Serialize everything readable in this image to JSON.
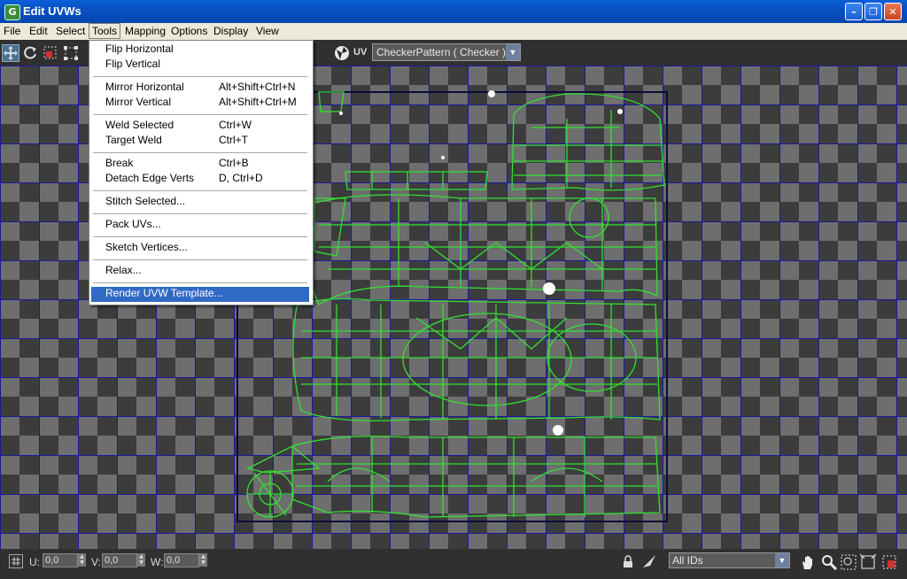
{
  "window": {
    "title": "Edit UVWs",
    "app_icon_glyph": "G"
  },
  "menubar": [
    "File",
    "Edit",
    "Select",
    "Tools",
    "Mapping",
    "Options",
    "Display",
    "View"
  ],
  "toolbar": {
    "uv_label": "UV",
    "texture_combo": "CheckerPattern  ( Checker )"
  },
  "tools_menu": {
    "items": [
      {
        "label": "Flip Horizontal",
        "shortcut": ""
      },
      {
        "label": "Flip Vertical",
        "shortcut": ""
      },
      {
        "label": "Mirror Horizontal",
        "shortcut": "Alt+Shift+Ctrl+N"
      },
      {
        "label": "Mirror Vertical",
        "shortcut": "Alt+Shift+Ctrl+M"
      },
      {
        "label": "Weld Selected",
        "shortcut": "Ctrl+W"
      },
      {
        "label": "Target Weld",
        "shortcut": "Ctrl+T"
      },
      {
        "label": "Break",
        "shortcut": "Ctrl+B"
      },
      {
        "label": "Detach Edge Verts",
        "shortcut": "D, Ctrl+D"
      },
      {
        "label": "Stitch Selected...",
        "shortcut": ""
      },
      {
        "label": "Pack UVs...",
        "shortcut": ""
      },
      {
        "label": "Sketch Vertices...",
        "shortcut": ""
      },
      {
        "label": "Relax...",
        "shortcut": ""
      },
      {
        "label": "Render UVW Template...",
        "shortcut": ""
      }
    ],
    "highlighted": "Render UVW Template..."
  },
  "statusbar": {
    "u_label": "U:",
    "u_value": "0,0",
    "v_label": "V:",
    "v_value": "0,0",
    "w_label": "W:",
    "w_value": "0,0",
    "ids_combo": "All IDs"
  },
  "colors": {
    "accent": "#316ac5",
    "wire": "#33e033",
    "uv_border": "#0c0c3a"
  }
}
